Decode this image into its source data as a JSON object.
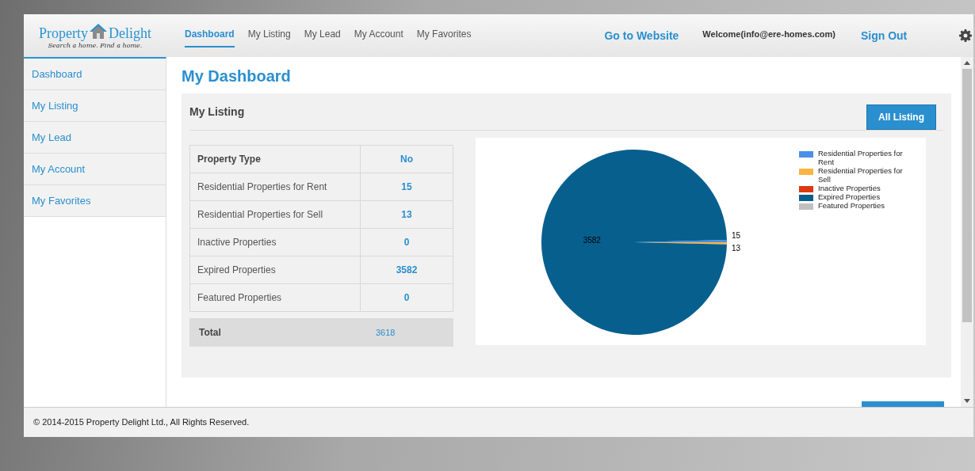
{
  "logo": {
    "word_1": "Property",
    "word_2": "Delight",
    "tagline": "Search a home. Find a home."
  },
  "nav": [
    {
      "label": "Dashboard",
      "selected": true
    },
    {
      "label": "My Listing",
      "selected": false
    },
    {
      "label": "My Lead",
      "selected": false
    },
    {
      "label": "My Account",
      "selected": false
    },
    {
      "label": "My Favorites",
      "selected": false
    }
  ],
  "header": {
    "website_link": "Go to Website",
    "welcome": "Welcome(info@ere-homes.com)",
    "sign_out": "Sign Out"
  },
  "sidebar": {
    "items": [
      {
        "label": "Dashboard",
        "selected": false
      },
      {
        "label": "My Listing",
        "selected": false
      },
      {
        "label": "My Lead",
        "selected": false
      },
      {
        "label": "My Account",
        "selected": false
      },
      {
        "label": "My Favorites",
        "selected": false
      }
    ]
  },
  "page_title": "My Dashboard",
  "listing": {
    "title": "My Listing",
    "button": "All Listing",
    "table": {
      "columns": [
        "Property Type",
        "No"
      ],
      "rows": [
        [
          "Residential Properties for Rent",
          "15"
        ],
        [
          "Residential Properties for Sell",
          "13"
        ],
        [
          "Inactive Properties",
          "0"
        ],
        [
          "Expired Properties",
          "3582"
        ],
        [
          "Featured Properties",
          "0"
        ]
      ],
      "total": [
        "Total",
        "3618"
      ]
    },
    "chart_data": {
      "type": "pie",
      "categories": [
        "Residential Properties for Rent",
        "Residential Properties for Sell",
        "Inactive Properties",
        "Expired Properties",
        "Featured Properties"
      ],
      "values": [
        15,
        13,
        0,
        3582,
        0
      ],
      "legend": true,
      "colors": [
        "#4a8fe8",
        "#f9b441",
        "#dc3912",
        "#075f8e",
        "#c0c0c0"
      ],
      "data_labels": true
    }
  },
  "footer": "© 2014-2015 Property Delight Ltd., All Rights Reserved."
}
